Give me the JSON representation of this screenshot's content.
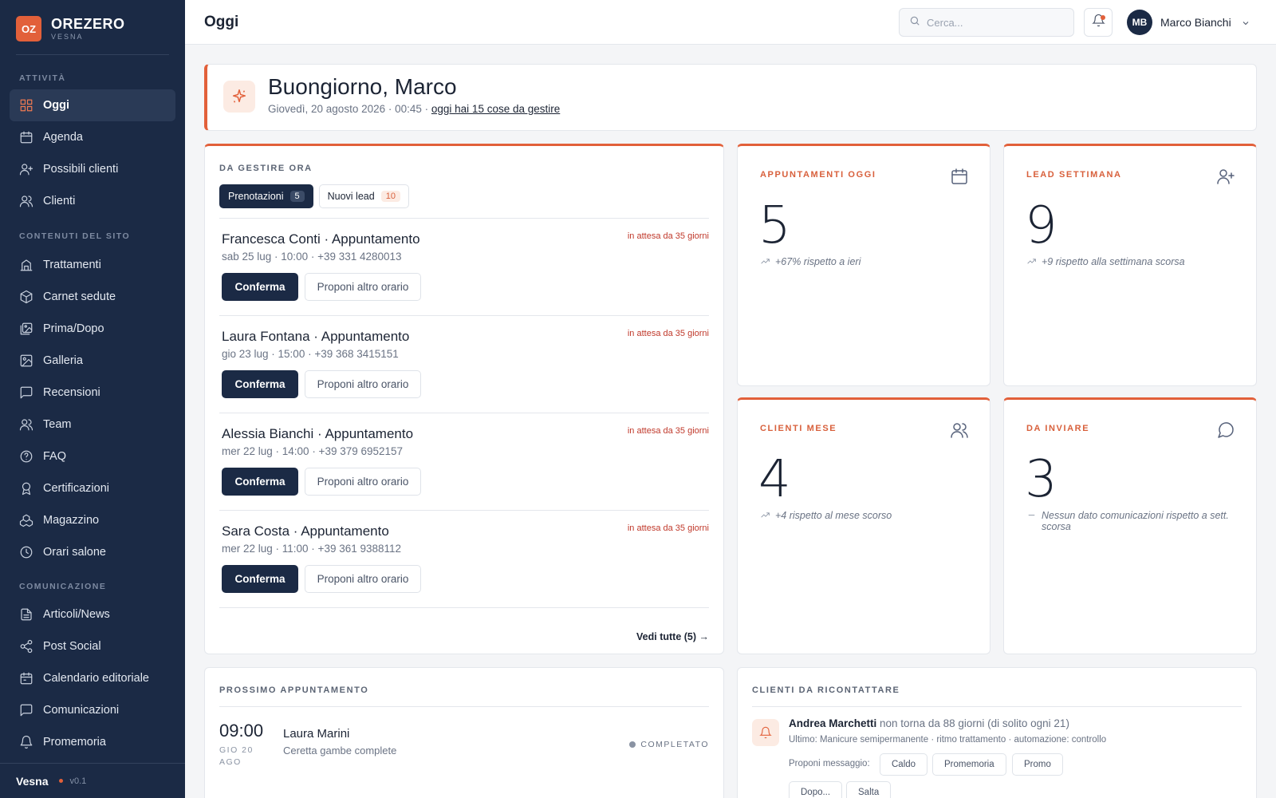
{
  "brand": {
    "logo": "OZ",
    "name": "OREZERO",
    "sub": "VESNA"
  },
  "sidebar": {
    "sections": [
      {
        "title": "ATTIVITÀ",
        "items": [
          {
            "label": "Oggi",
            "icon": "grid-icon",
            "active": true
          },
          {
            "label": "Agenda",
            "icon": "calendar-icon"
          },
          {
            "label": "Possibili clienti",
            "icon": "user-plus-icon"
          },
          {
            "label": "Clienti",
            "icon": "users-icon"
          }
        ]
      },
      {
        "title": "CONTENUTI DEL SITO",
        "items": [
          {
            "label": "Trattamenti",
            "icon": "building-icon"
          },
          {
            "label": "Carnet sedute",
            "icon": "package-icon"
          },
          {
            "label": "Prima/Dopo",
            "icon": "images-icon"
          },
          {
            "label": "Galleria",
            "icon": "image-icon"
          },
          {
            "label": "Recensioni",
            "icon": "message-square-icon"
          },
          {
            "label": "Team",
            "icon": "team-icon"
          },
          {
            "label": "FAQ",
            "icon": "help-circle-icon"
          },
          {
            "label": "Certificazioni",
            "icon": "award-icon"
          },
          {
            "label": "Magazzino",
            "icon": "boxes-icon"
          },
          {
            "label": "Orari salone",
            "icon": "clock-icon"
          }
        ]
      },
      {
        "title": "COMUNICAZIONE",
        "items": [
          {
            "label": "Articoli/News",
            "icon": "file-text-icon"
          },
          {
            "label": "Post Social",
            "icon": "share-icon"
          },
          {
            "label": "Calendario editoriale",
            "icon": "calendar-edit-icon"
          },
          {
            "label": "Comunicazioni",
            "icon": "chat-icon"
          },
          {
            "label": "Promemoria",
            "icon": "bell-ring-icon"
          }
        ]
      }
    ],
    "footer": {
      "name": "Vesna",
      "version": "v0.1"
    }
  },
  "header": {
    "title": "Oggi",
    "search_placeholder": "Cerca...",
    "user": {
      "initials": "MB",
      "name": "Marco Bianchi"
    }
  },
  "greeting": {
    "title": "Buongiorno, Marco",
    "date_text": "Giovedì, 20 agosto 2026 · 00:45 · ",
    "link_text": "oggi hai 15 cose da gestire"
  },
  "todo": {
    "title": "DA GESTIRE ORA",
    "tabs": [
      {
        "label": "Prenotazioni",
        "count": "5",
        "active": true
      },
      {
        "label": "Nuovi lead",
        "count": "10",
        "active": false
      }
    ],
    "bookings": [
      {
        "name": "Francesca Conti · Appuntamento",
        "detail": "sab 25 lug · 10:00 · +39 331 4280013",
        "wait": "in attesa da 35 giorni",
        "confirm": "Conferma",
        "propose": "Proponi altro orario"
      },
      {
        "name": "Laura Fontana · Appuntamento",
        "detail": "gio 23 lug · 15:00 · +39 368 3415151",
        "wait": "in attesa da 35 giorni",
        "confirm": "Conferma",
        "propose": "Proponi altro orario"
      },
      {
        "name": "Alessia Bianchi · Appuntamento",
        "detail": "mer 22 lug · 14:00 · +39 379 6952157",
        "wait": "in attesa da 35 giorni",
        "confirm": "Conferma",
        "propose": "Proponi altro orario"
      },
      {
        "name": "Sara Costa · Appuntamento",
        "detail": "mer 22 lug · 11:00 · +39 361 9388112",
        "wait": "in attesa da 35 giorni",
        "confirm": "Conferma",
        "propose": "Proponi altro orario"
      }
    ],
    "see_all": "Vedi tutte (5) →"
  },
  "stats": [
    {
      "label": "APPUNTAMENTI OGGI",
      "value": "5",
      "trend": "+67% rispetto a ieri",
      "icon": "calendar-icon",
      "trend_icon": "trend-up-icon"
    },
    {
      "label": "LEAD SETTIMANA",
      "value": "9",
      "trend": "+9 rispetto alla settimana scorsa",
      "icon": "user-plus-icon",
      "trend_icon": "trend-up-icon"
    },
    {
      "label": "CLIENTI MESE",
      "value": "4",
      "trend": "+4 rispetto al mese scorso",
      "icon": "users-icon",
      "trend_icon": "trend-up-icon"
    },
    {
      "label": "DA INVIARE",
      "value": "3",
      "trend": "Nessun dato comunicazioni rispetto a sett. scorsa",
      "icon": "chat-icon",
      "trend_icon": "trend-neutral-icon"
    }
  ],
  "next_appointment": {
    "title": "PROSSIMO APPUNTAMENTO",
    "time": "09:00",
    "date": "GIO 20 AGO",
    "client": "Laura Marini",
    "service": "Ceretta gambe complete",
    "status": "COMPLETATO"
  },
  "recontact": {
    "title": "CLIENTI DA RICONTATTARE",
    "name": "Andrea Marchetti",
    "summary": " non torna da 88 giorni (di solito ogni 21)",
    "last": "Ultimo: Manicure semipermanente · ritmo trattamento · automazione: controllo",
    "propose_label": "Proponi messaggio:",
    "chips": [
      "Caldo",
      "Promemoria",
      "Promo",
      "Dopo...",
      "Salta"
    ]
  }
}
